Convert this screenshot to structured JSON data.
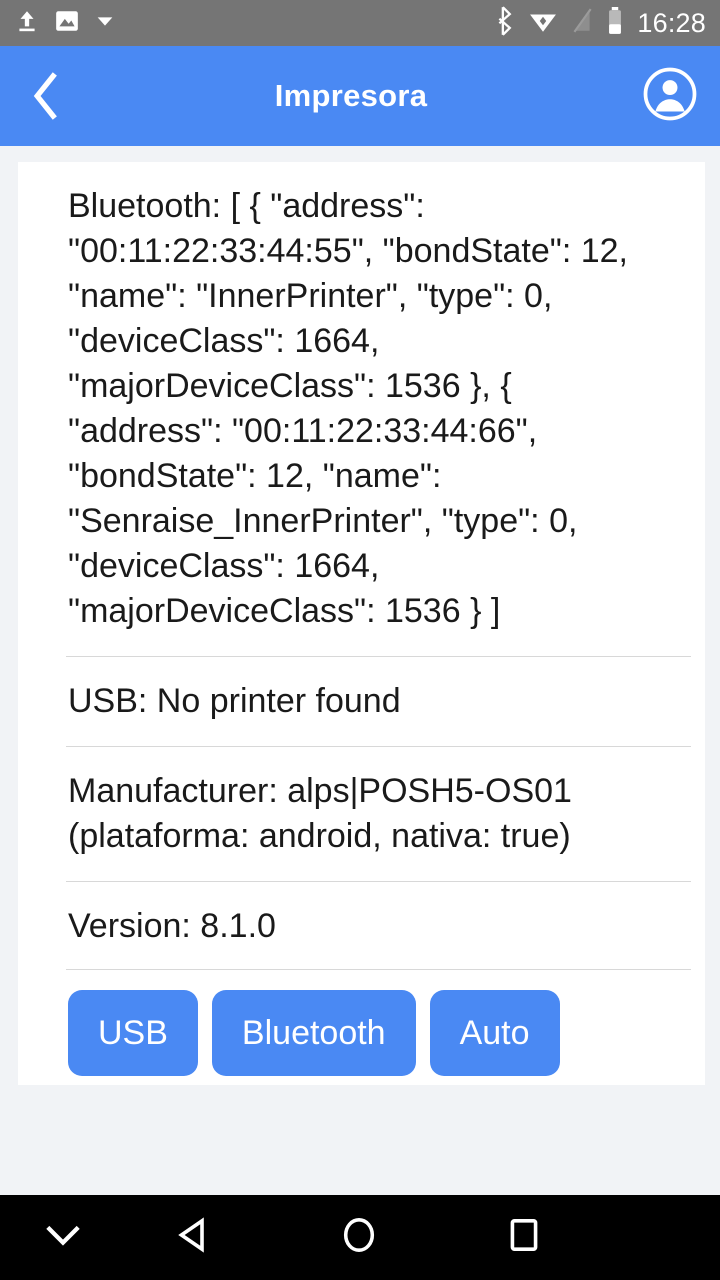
{
  "status_bar": {
    "time": "16:28",
    "left_icons": [
      "upload-icon",
      "image-icon",
      "dropdown-arrow-icon"
    ],
    "right_icons": [
      "bluetooth-icon",
      "wifi-icon",
      "signal-off-icon",
      "battery-icon"
    ],
    "background_color": "#757575"
  },
  "app_bar": {
    "title": "Impresora",
    "back_icon": "chevron-left-icon",
    "account_icon": "account-circle-icon",
    "background_color": "#4a89f3"
  },
  "content": {
    "bluetooth_line": "Bluetooth: [ { \"address\": \"00:11:22:33:44:55\", \"bondState\": 12, \"name\": \"InnerPrinter\", \"type\": 0, \"deviceClass\": 1664, \"majorDeviceClass\": 1536 }, { \"address\": \"00:11:22:33:44:66\", \"bondState\": 12, \"name\": \"Senraise_InnerPrinter\", \"type\": 0, \"deviceClass\": 1664, \"majorDeviceClass\": 1536 } ]",
    "usb_line": "USB: No printer found",
    "manufacturer_line": "Manufacturer: alps|POSH5-OS01 (plataforma: android, nativa: true)",
    "version_line": "Version: 8.1.0"
  },
  "actions": {
    "buttons": [
      {
        "label": "USB",
        "name": "usb-print-button"
      },
      {
        "label": "Bluetooth",
        "name": "bluetooth-print-button"
      },
      {
        "label": "Auto",
        "name": "auto-print-button"
      }
    ],
    "accent_color": "#4a89f3"
  },
  "nav_bar": {
    "background_color": "#000000",
    "items": [
      "hide-keyboard-icon",
      "back-icon",
      "home-icon",
      "recents-icon"
    ]
  }
}
